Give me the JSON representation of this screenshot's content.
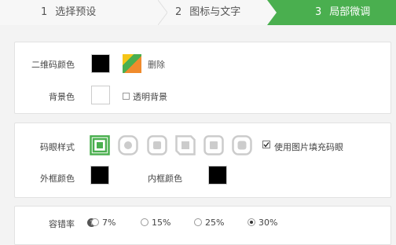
{
  "steps": [
    {
      "num": "1",
      "label": "选择预设"
    },
    {
      "num": "2",
      "label": "图标与文字"
    },
    {
      "num": "3",
      "label": "局部微调"
    }
  ],
  "colors": {
    "accent": "#4aaf4f",
    "qr_color": "#000000",
    "bg_color": "#ffffff",
    "outer_frame": "#000000",
    "inner_frame": "#000000"
  },
  "color_panel": {
    "qr_color_label": "二维码颜色",
    "delete_label": "删除",
    "bg_label": "背景色",
    "transparent_label": "透明背景"
  },
  "eye_panel": {
    "eye_style_label": "码眼样式",
    "use_image_label": "使用图片填充码眼",
    "outer_label": "外框颜色",
    "inner_label": "内框颜色",
    "eye_styles": [
      "square",
      "circle",
      "rounded",
      "notch",
      "rounded-2",
      "soft"
    ],
    "selected_eye": 0
  },
  "ecc_panel": {
    "label": "容错率",
    "help_icon": "question-circle-icon",
    "options": [
      "7%",
      "15%",
      "25%",
      "30%"
    ],
    "selected": "30%"
  }
}
